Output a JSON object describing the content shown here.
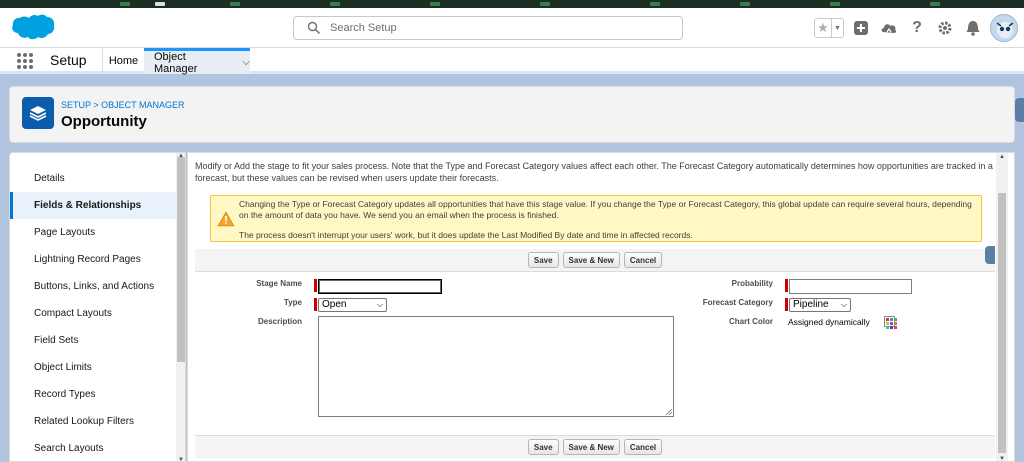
{
  "header": {
    "search_placeholder": "Search Setup",
    "icons": [
      "star-icon",
      "add-icon",
      "trailhead-icon",
      "help-icon",
      "gear-icon",
      "bell-icon",
      "avatar"
    ]
  },
  "context": {
    "app_name": "Setup",
    "tabs": [
      {
        "label": "Home"
      },
      {
        "label": "Object Manager"
      }
    ]
  },
  "page": {
    "breadcrumb": "SETUP > OBJECT MANAGER",
    "title": "Opportunity"
  },
  "sidebar": {
    "items": [
      {
        "label": "Details"
      },
      {
        "label": "Fields & Relationships"
      },
      {
        "label": "Page Layouts"
      },
      {
        "label": "Lightning Record Pages"
      },
      {
        "label": "Buttons, Links, and Actions"
      },
      {
        "label": "Compact Layouts"
      },
      {
        "label": "Field Sets"
      },
      {
        "label": "Object Limits"
      },
      {
        "label": "Record Types"
      },
      {
        "label": "Related Lookup Filters"
      },
      {
        "label": "Search Layouts"
      }
    ],
    "active_index": 1
  },
  "content": {
    "intro": "Modify or Add the stage to fit your sales process. Note that the Type and Forecast Category values affect each other. The Forecast Category automatically determines how opportunities are tracked in a forecast, but these values can be revised when users update their forecasts.",
    "warning_line1": "Changing the Type or Forecast Category updates all opportunities that have this stage value. If you change the Type or Forecast Category, this global update can require several hours, depending on the amount of data you have. We send you an email when the process is finished.",
    "warning_line2": "The process doesn't interrupt your users' work, but it does update the Last Modified By date and time in affected records.",
    "buttons": {
      "save": "Save",
      "save_new": "Save & New",
      "cancel": "Cancel"
    },
    "fields": {
      "stage_name_label": "Stage Name",
      "stage_name_value": "",
      "type_label": "Type",
      "type_value": "Open",
      "description_label": "Description",
      "description_value": "",
      "probability_label": "Probability",
      "probability_value": "",
      "forecast_category_label": "Forecast Category",
      "forecast_category_value": "Pipeline",
      "chart_color_label": "Chart Color",
      "chart_color_value": "Assigned dynamically"
    }
  },
  "colors": {
    "brand_blue": "#0176d3",
    "icon_blue": "#0b5cab",
    "warning_bg": "#fff8c4",
    "required_red": "#c00000"
  }
}
